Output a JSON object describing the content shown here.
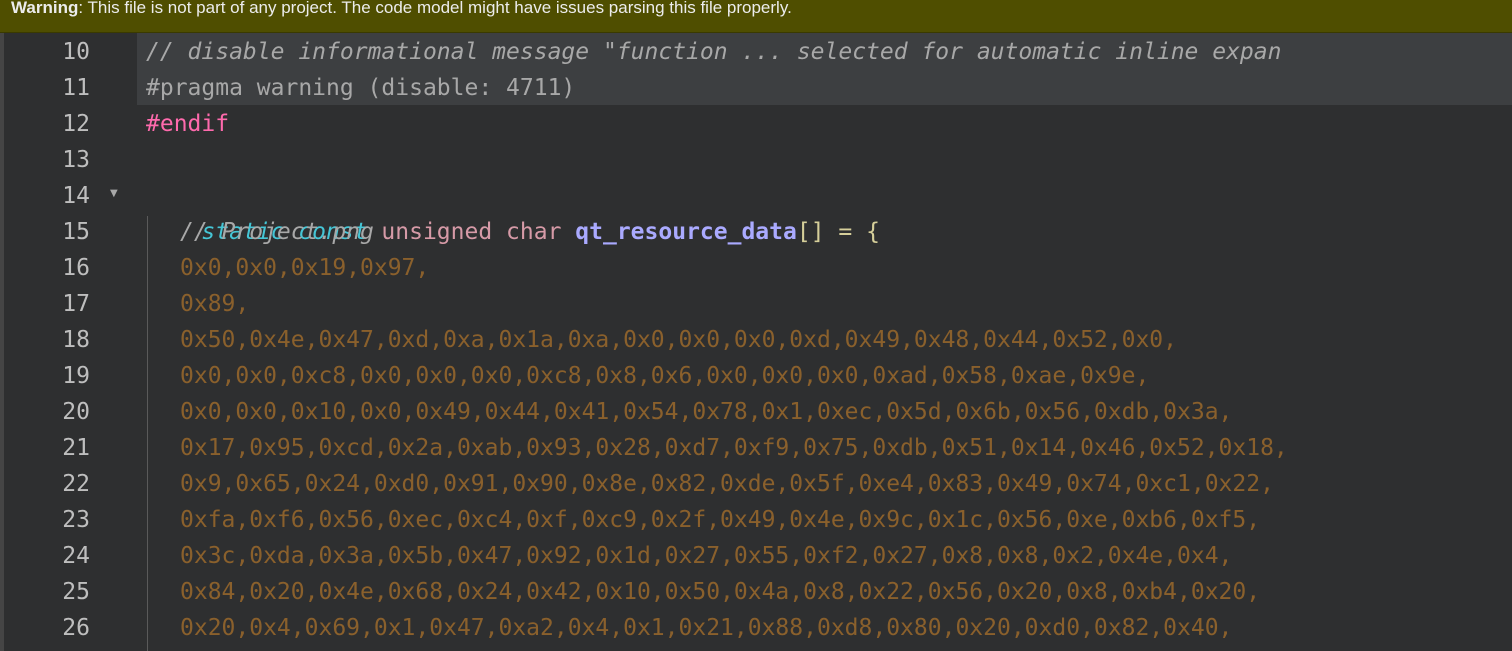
{
  "warning": {
    "label": "Warning",
    "message": ": This file is not part of any project. The code model might have issues parsing this file properly."
  },
  "lines": [
    {
      "num": "10",
      "text": "// disable informational message \"function ... selected for automatic inline expan"
    },
    {
      "num": "11",
      "text": "#pragma warning (disable: 4711)"
    },
    {
      "num": "12",
      "text": "#endif"
    },
    {
      "num": "13",
      "text": ""
    },
    {
      "num": "14",
      "keyword": "static const",
      "type": "unsigned char",
      "ident": "qt_resource_data",
      "rest": "[] = {"
    },
    {
      "num": "15",
      "text": "// Project.png"
    },
    {
      "num": "16",
      "text": "0x0,0x0,0x19,0x97,"
    },
    {
      "num": "17",
      "text": "0x89,"
    },
    {
      "num": "18",
      "text": "0x50,0x4e,0x47,0xd,0xa,0x1a,0xa,0x0,0x0,0x0,0xd,0x49,0x48,0x44,0x52,0x0,"
    },
    {
      "num": "19",
      "text": "0x0,0x0,0xc8,0x0,0x0,0x0,0xc8,0x8,0x6,0x0,0x0,0x0,0xad,0x58,0xae,0x9e,"
    },
    {
      "num": "20",
      "text": "0x0,0x0,0x10,0x0,0x49,0x44,0x41,0x54,0x78,0x1,0xec,0x5d,0x6b,0x56,0xdb,0x3a,"
    },
    {
      "num": "21",
      "text": "0x17,0x95,0xcd,0x2a,0xab,0x93,0x28,0xd7,0xf9,0x75,0xdb,0x51,0x14,0x46,0x52,0x18,"
    },
    {
      "num": "22",
      "text": "0x9,0x65,0x24,0xd0,0x91,0x90,0x8e,0x82,0xde,0x5f,0xe4,0x83,0x49,0x74,0xc1,0x22,"
    },
    {
      "num": "23",
      "text": "0xfa,0xf6,0x56,0xec,0xc4,0xf,0xc9,0x2f,0x49,0x4e,0x9c,0x1c,0x56,0xe,0xb6,0xf5,"
    },
    {
      "num": "24",
      "text": "0x3c,0xda,0x3a,0x5b,0x47,0x92,0x1d,0x27,0x55,0xf2,0x27,0x8,0x8,0x2,0x4e,0x4,"
    },
    {
      "num": "25",
      "text": "0x84,0x20,0x4e,0x68,0x24,0x42,0x10,0x50,0x4a,0x8,0x22,0x56,0x20,0x8,0xb4,0x20,"
    },
    {
      "num": "26",
      "text": "0x20,0x4,0x69,0x1,0x47,0xa2,0x4,0x1,0x21,0x88,0xd8,0x80,0x20,0xd0,0x82,0x40,"
    }
  ],
  "fold_icon": "triangle-down-icon",
  "colors": {
    "warning_bg": "#4f4e00",
    "editor_bg": "#2e2f30",
    "comment": "#a8a8a8",
    "preprocessor": "#ff6aad",
    "keyword": "#45c6d6",
    "type": "#d69aa7",
    "identifier": "#aaaaff",
    "hex_literal": "#8a602c"
  }
}
